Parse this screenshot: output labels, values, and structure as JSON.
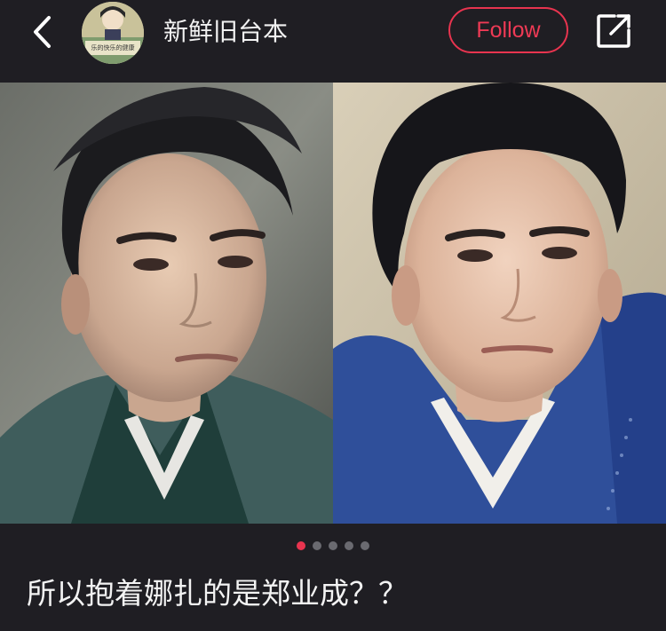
{
  "header": {
    "username": "新鲜旧台本",
    "avatar_text": "乐的快乐的健康",
    "follow_label": "Follow",
    "back_icon": "chevron-left-icon",
    "share_icon": "share-external-icon"
  },
  "carousel": {
    "total_slides": 5,
    "active_index": 0,
    "images": [
      {
        "name": "left-portrait"
      },
      {
        "name": "right-portrait"
      }
    ]
  },
  "post": {
    "caption": "所以抱着娜扎的是郑业成？？"
  },
  "colors": {
    "background": "#1f1e23",
    "accent": "#e8344f",
    "dot_inactive": "#6a6a70",
    "text": "#f2f2f2"
  }
}
